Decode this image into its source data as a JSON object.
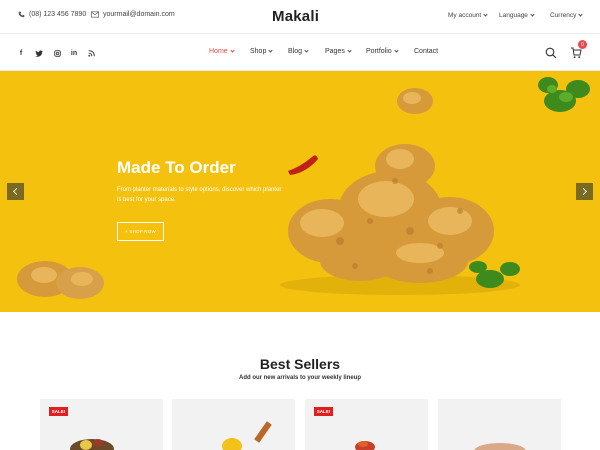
{
  "topbar": {
    "phone": "(08) 123 456 7890",
    "email": "yourmail@domain.com",
    "logo": "Makali",
    "my_account": "My account",
    "language": "Language",
    "currency": "Currency"
  },
  "social": [
    "f",
    "t",
    "o",
    "in",
    "rss"
  ],
  "nav": {
    "items": [
      {
        "label": "Home",
        "dropdown": true,
        "active": true
      },
      {
        "label": "Shop",
        "dropdown": true
      },
      {
        "label": "Blog",
        "dropdown": true
      },
      {
        "label": "Pages",
        "dropdown": true
      },
      {
        "label": "Portfolio",
        "dropdown": true
      },
      {
        "label": "Contact",
        "dropdown": false
      }
    ],
    "cart_count": "0"
  },
  "hero": {
    "title": "Made To Order",
    "description": "From planter materials to style options, discover which planter is best for your space.",
    "button": "+ SHOP NOW",
    "background": "#f3c10e"
  },
  "best_sellers": {
    "title": "Best Sellers",
    "subtitle": "Add our new arrivals to your weekly lineup",
    "products": [
      {
        "badge": "SALE!"
      },
      {
        "badge": ""
      },
      {
        "badge": "SALE!"
      },
      {
        "badge": ""
      }
    ]
  },
  "colors": {
    "accent": "#e9484d",
    "sale_badge": "#e02020",
    "hero_yellow": "#f3c10e"
  }
}
